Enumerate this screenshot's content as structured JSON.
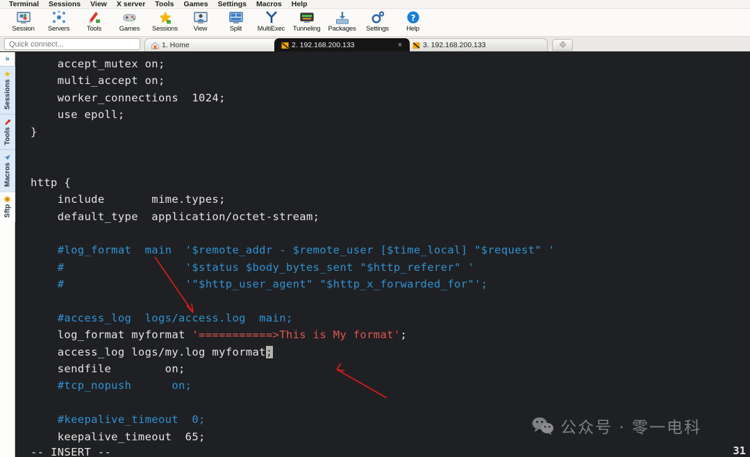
{
  "menubar": {
    "items": [
      {
        "label": "Terminal"
      },
      {
        "label": "Sessions"
      },
      {
        "label": "View"
      },
      {
        "label": "X server"
      },
      {
        "label": "Tools"
      },
      {
        "label": "Games"
      },
      {
        "label": "Settings"
      },
      {
        "label": "Macros"
      },
      {
        "label": "Help"
      }
    ]
  },
  "toolbar": {
    "buttons": [
      {
        "label": "Session",
        "icon": "session-icon"
      },
      {
        "label": "Servers",
        "icon": "servers-icon"
      },
      {
        "label": "Tools",
        "icon": "tools-icon"
      },
      {
        "label": "Games",
        "icon": "games-icon"
      },
      {
        "label": "Sessions",
        "icon": "sessions-star-icon"
      },
      {
        "label": "View",
        "icon": "view-icon"
      },
      {
        "label": "Split",
        "icon": "split-icon"
      },
      {
        "label": "MultiExec",
        "icon": "multiexec-icon"
      },
      {
        "label": "Tunneling",
        "icon": "tunneling-icon"
      },
      {
        "label": "Packages",
        "icon": "packages-icon"
      },
      {
        "label": "Settings",
        "icon": "settings-gear-icon"
      },
      {
        "label": "Help",
        "icon": "help-question-icon"
      }
    ]
  },
  "quick_connect": {
    "placeholder": "Quick connect..."
  },
  "tabs": [
    {
      "label": "1. Home",
      "icon": "home-icon",
      "state": "inactive"
    },
    {
      "label": "2. 192.168.200.133",
      "icon": "terminal-icon",
      "state": "active",
      "close": "×"
    },
    {
      "label": "3. 192.168.200.133",
      "icon": "terminal-icon",
      "state": "inactive"
    }
  ],
  "new_tab_button": {
    "label": "+"
  },
  "sidebar": {
    "expander": "»",
    "tabs": [
      {
        "label": "Sessions",
        "icon": "star-icon",
        "selected": false
      },
      {
        "label": "Tools",
        "icon": "wrench-icon",
        "selected": false
      },
      {
        "label": "Macros",
        "icon": "macro-icon",
        "selected": false
      },
      {
        "label": "Sftp",
        "icon": "sftp-icon",
        "selected": true
      }
    ]
  },
  "terminal": {
    "lines": [
      [
        {
          "t": "    accept_mutex on;",
          "c": "plain"
        }
      ],
      [
        {
          "t": "    multi_accept on;",
          "c": "plain"
        }
      ],
      [
        {
          "t": "    worker_connections  1024;",
          "c": "plain"
        }
      ],
      [
        {
          "t": "    use epoll;",
          "c": "plain"
        }
      ],
      [
        {
          "t": "}",
          "c": "plain"
        }
      ],
      [
        {
          "t": "",
          "c": "plain"
        }
      ],
      [
        {
          "t": "",
          "c": "plain"
        }
      ],
      [
        {
          "t": "http {",
          "c": "plain"
        }
      ],
      [
        {
          "t": "    include       mime.types;",
          "c": "plain"
        }
      ],
      [
        {
          "t": "    default_type  application/octet-stream;",
          "c": "plain"
        }
      ],
      [
        {
          "t": "",
          "c": "plain"
        }
      ],
      [
        {
          "t": "    #log_format  main  '$remote_addr - $remote_user [$time_local] \"$request\" '",
          "c": "cmt"
        }
      ],
      [
        {
          "t": "    #                  '$status $body_bytes_sent \"$http_referer\" '",
          "c": "cmt"
        }
      ],
      [
        {
          "t": "    #                  '\"$http_user_agent\" \"$http_x_forwarded_for\"';",
          "c": "cmt"
        }
      ],
      [
        {
          "t": "",
          "c": "plain"
        }
      ],
      [
        {
          "t": "    #access_log  logs/access.log  main;",
          "c": "cmt"
        }
      ],
      [
        {
          "t": "    log_format myformat ",
          "c": "plain"
        },
        {
          "t": "'===========>This is My format'",
          "c": "red"
        },
        {
          "t": ";",
          "c": "plain"
        }
      ],
      [
        {
          "t": "    access_log logs/my.log myformat",
          "c": "plain"
        },
        {
          "t": ";",
          "c": "cursor"
        }
      ],
      [
        {
          "t": "    sendfile        on;",
          "c": "plain"
        }
      ],
      [
        {
          "t": "    #tcp_nopush      on;",
          "c": "cmt"
        }
      ],
      [
        {
          "t": "",
          "c": "plain"
        }
      ],
      [
        {
          "t": "    #keepalive_timeout  0;",
          "c": "cmt"
        }
      ],
      [
        {
          "t": "    keepalive_timeout  65;",
          "c": "plain"
        }
      ]
    ],
    "status": "-- INSERT --",
    "line_number": "31"
  },
  "watermark": {
    "text": "公众号 · 零一电科",
    "icon": "wechat-icon"
  },
  "colors": {
    "terminal_bg": "#1f2023",
    "comment_blue": "#2f93d4",
    "string_red": "#e0564e",
    "text": "#e8e6e3",
    "annotation_red": "#e01b1b"
  }
}
